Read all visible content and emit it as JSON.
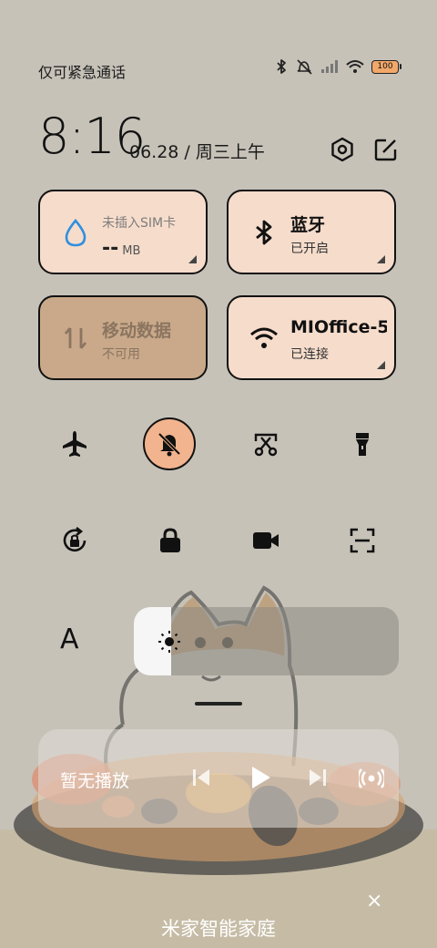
{
  "status": {
    "carrier": "仅可紧急通话",
    "battery": "100"
  },
  "header": {
    "time": "8:16",
    "date": "06.28 / 周三上午"
  },
  "tiles": {
    "sim": {
      "title": "未插入SIM卡",
      "value": "--",
      "unit": "MB"
    },
    "bluetooth": {
      "title": "蓝牙",
      "status": "已开启"
    },
    "mobile_data": {
      "title": "移动数据",
      "status": "不可用"
    },
    "wifi": {
      "title": "MIOffice-5",
      "status": "已连接"
    }
  },
  "toggles_row1": [
    "airplane-mode",
    "silent-mode",
    "screenshot",
    "flashlight"
  ],
  "toggles_row2": [
    "auto-rotate",
    "lock-screen",
    "screen-recorder",
    "scanner"
  ],
  "brightness": {
    "font_label": "A",
    "level": 0.14
  },
  "media": {
    "label": "暂无播放"
  },
  "footer": {
    "label": "米家智能家庭",
    "close": "×"
  },
  "colors": {
    "tile": "#f6dccb",
    "tile_disabled": "#c9a98a",
    "active_toggle": "#f2b48e",
    "background": "#c6c2b8"
  }
}
